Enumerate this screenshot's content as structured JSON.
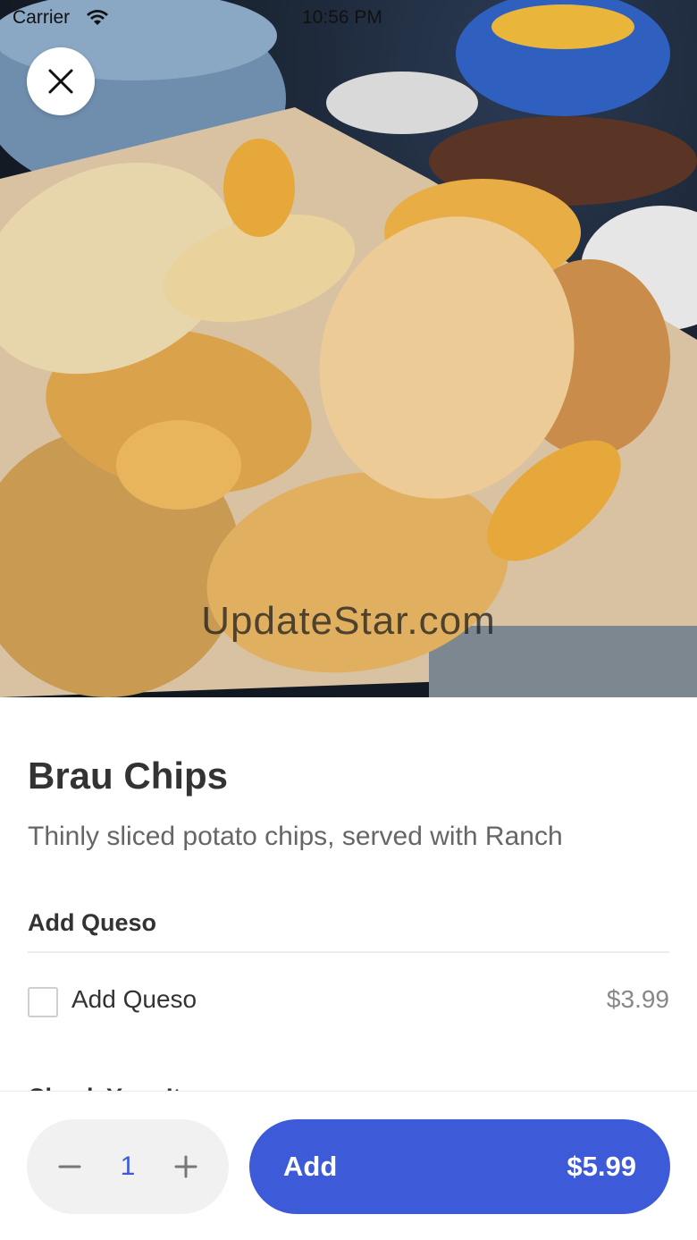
{
  "status_bar": {
    "carrier": "Carrier",
    "time": "10:56 PM"
  },
  "hero": {
    "watermark": "UpdateStar.com"
  },
  "item": {
    "title": "Brau Chips",
    "description": "Thinly sliced potato chips, served with Ranch"
  },
  "modifier_group": {
    "title": "Add Queso",
    "options": [
      {
        "label": "Add Queso",
        "price": "$3.99",
        "checked": false
      }
    ]
  },
  "next_group": {
    "title": "Check Your Items"
  },
  "footer": {
    "quantity": "1",
    "add_label": "Add",
    "total": "$5.99"
  },
  "colors": {
    "accent": "#3d5bd9",
    "stepper_bg": "#f1f1f1"
  }
}
